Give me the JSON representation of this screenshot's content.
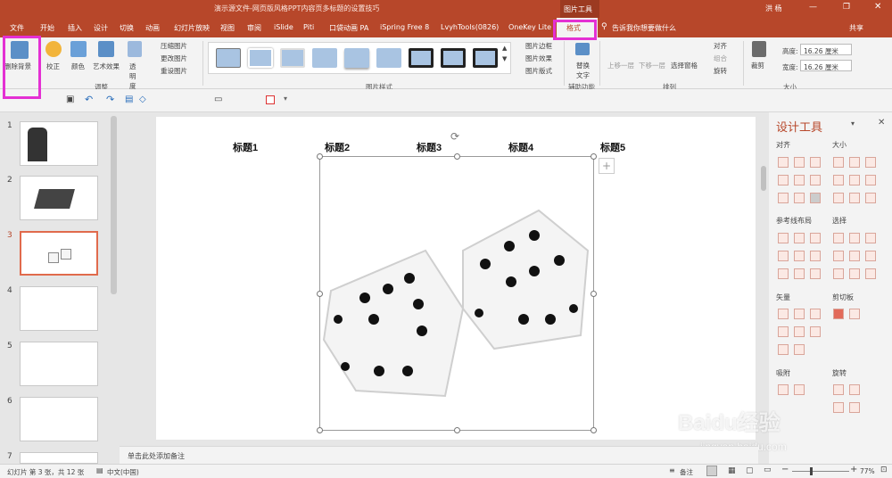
{
  "window": {
    "title": "演示源文件-网页版风格PPT内容页多标题的设置技巧",
    "context_label": "图片工具",
    "user": "洪 杨",
    "share": "共享"
  },
  "tabs": [
    "文件",
    "开始",
    "插入",
    "设计",
    "切换",
    "动画",
    "幻灯片放映",
    "视图",
    "审阅",
    "iSlide",
    "Piti",
    "口袋动画 PA",
    "iSpring Free 8",
    "LvyhTools(0826)",
    "OneKey Lite",
    "格式"
  ],
  "search": {
    "placeholder": "告诉我你想要做什么"
  },
  "ribbon": {
    "remove_bg": "删除背景",
    "correct": "校正",
    "color": "颜色",
    "art_effects": "艺术效果",
    "transparency": "透明度",
    "compress": "压缩图片",
    "change_pic": "更改图片",
    "reset_pic": "重设图片",
    "group_adjust": "调整",
    "group_pic_styles": "图片样式",
    "pic_border": "图片边框",
    "pic_effects": "图片效果",
    "pic_layout": "图片版式",
    "alt_text": "替换文字",
    "group_aux": "辅助功能",
    "bring_forward": "上移一层",
    "send_backward": "下移一层",
    "sel_pane": "选择窗格",
    "align": "对齐",
    "group_obj": "组合",
    "rotate": "旋转",
    "group_arrange": "排列",
    "crop": "裁剪",
    "height_label": "高度:",
    "height_value": "16.26 厘米",
    "width_label": "宽度:",
    "width_value": "16.26 厘米",
    "group_size": "大小"
  },
  "slides": [
    "1",
    "2",
    "3",
    "4",
    "5",
    "6",
    "7"
  ],
  "slide_headings": [
    "标题1",
    "标题2",
    "标题3",
    "标题4",
    "标题5"
  ],
  "design_pane": {
    "title": "设计工具",
    "sections": [
      "对齐",
      "大小",
      "参考线布局",
      "选择",
      "矢量",
      "剪切板",
      "吸附",
      "旋转"
    ]
  },
  "notes_placeholder": "单击此处添加备注",
  "status": {
    "slide_info": "幻灯片 第 3 张，共 12 张",
    "language": "中文(中国)",
    "notes": "备注",
    "zoom": "77%"
  },
  "watermark": {
    "brand": "Baidu经验",
    "url": "jingyan.baidu.com"
  }
}
